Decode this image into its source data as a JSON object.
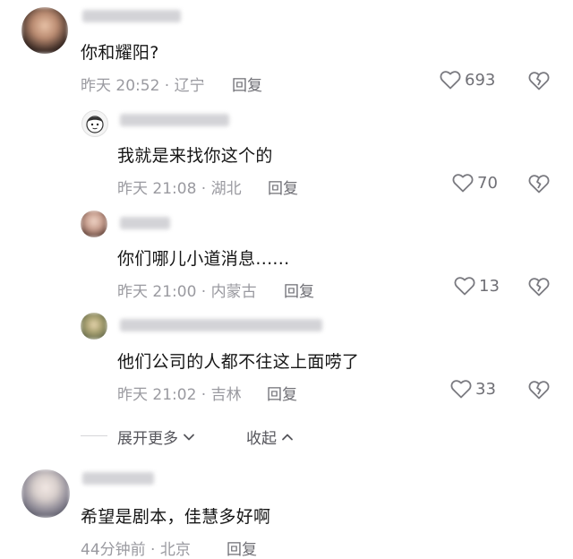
{
  "comments": [
    {
      "text": "你和耀阳?",
      "time_loc": "昨天 20:52 · 辽宁",
      "reply_label": "回复",
      "likes": "693"
    },
    {
      "text": "我就是来找你这个的",
      "time_loc": "昨天 21:08 · 湖北",
      "reply_label": "回复",
      "likes": "70"
    },
    {
      "text": "你们哪儿小道消息......",
      "time_loc": "昨天 21:00 · 内蒙古",
      "reply_label": "回复",
      "likes": "13"
    },
    {
      "text": "他们公司的人都不往这上面唠了",
      "time_loc": "昨天 21:02 · 吉林",
      "reply_label": "回复",
      "likes": "33"
    },
    {
      "text": "希望是剧本，佳慧多好啊",
      "time_loc": "44分钟前 · 北京",
      "reply_label": "回复"
    }
  ],
  "expand_more_label": "展开更多",
  "collapse_label": "收起",
  "icons": {
    "like": "heart-outline-icon",
    "dislike": "broken-heart-icon",
    "expand": "chevron-down-icon",
    "collapse": "chevron-up-icon"
  }
}
